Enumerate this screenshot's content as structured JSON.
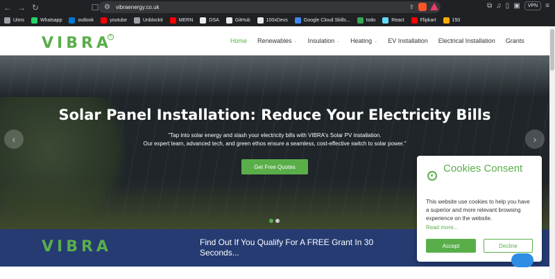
{
  "browser": {
    "url": "vibraenergy.co.uk",
    "vpn_label": "VPN",
    "bookmarks": [
      {
        "label": "Uims",
        "color": "#9aa0a6"
      },
      {
        "label": "Whatsapp",
        "color": "#25d366"
      },
      {
        "label": "outlook",
        "color": "#0078d4"
      },
      {
        "label": "youtube",
        "color": "#ff0000"
      },
      {
        "label": "Unblockit",
        "color": "#9aa0a6"
      },
      {
        "label": "MERN",
        "color": "#ff0000"
      },
      {
        "label": "DSA",
        "color": "#e8eaed"
      },
      {
        "label": "GitHub",
        "color": "#e8eaed"
      },
      {
        "label": "100xDevs",
        "color": "#e8eaed"
      },
      {
        "label": "Google Cloud Skills...",
        "color": "#4285f4"
      },
      {
        "label": "todo",
        "color": "#34a853"
      },
      {
        "label": "React",
        "color": "#61dafb"
      },
      {
        "label": "Flipkart",
        "color": "#ff0000"
      },
      {
        "label": "150",
        "color": "#f9ab00"
      }
    ]
  },
  "site": {
    "logo_text": "VIBRA",
    "logo_mark": "®",
    "menu": [
      {
        "label": "Home",
        "active": true,
        "dropdown": false
      },
      {
        "label": "Renewables",
        "active": false,
        "dropdown": true
      },
      {
        "label": "Insulation",
        "active": false,
        "dropdown": true
      },
      {
        "label": "Heating",
        "active": false,
        "dropdown": true
      },
      {
        "label": "EV Installation",
        "active": false,
        "dropdown": false
      },
      {
        "label": "Electrical Installation",
        "active": false,
        "dropdown": false
      },
      {
        "label": "Grants",
        "active": false,
        "dropdown": false
      }
    ],
    "hero": {
      "title": "Solar Panel Installation: Reduce Your Electricity Bills",
      "line1": "\"Tap into solar energy and slash your electricity bills with VIBRA's Solar PV installation.",
      "line2": "Our expert team, advanced tech, and green ethos ensure a seamless, cost-effective switch to solar power.\"",
      "cta": "Get Free Quotes",
      "prev": "‹",
      "next": "›"
    },
    "banner": {
      "logo_text": "VIBRA",
      "text": "Find Out If You Qualify For A FREE Grant In 30 Seconds..."
    }
  },
  "cookie": {
    "title": "Cookies Consent",
    "body": "This website use cookies to help you have a superior and more relevant browsing experience on the website.",
    "link": "Read more...",
    "accept": "Accept",
    "decline": "Decline"
  },
  "colors": {
    "brand_green": "#5aae4a",
    "banner_blue": "#253b72"
  }
}
